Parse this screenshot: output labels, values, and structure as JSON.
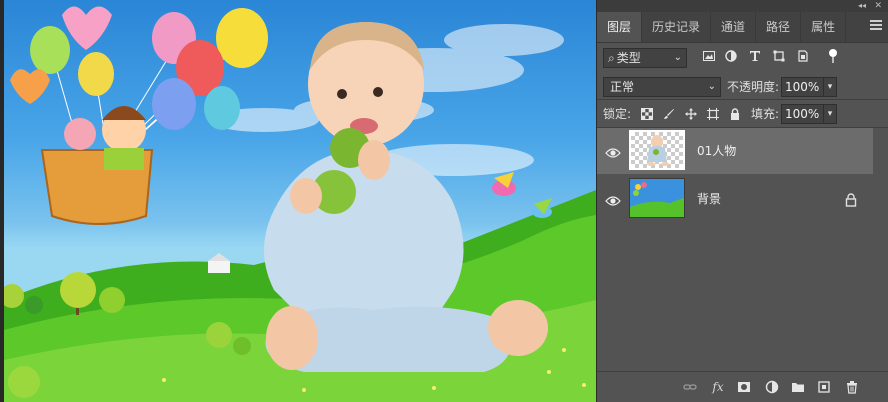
{
  "panel": {
    "tabs": [
      {
        "label": "图层",
        "active": true
      },
      {
        "label": "历史记录",
        "active": false
      },
      {
        "label": "通道",
        "active": false
      },
      {
        "label": "路径",
        "active": false
      },
      {
        "label": "属性",
        "active": false
      }
    ],
    "top_strip": {
      "collapse": "◂◂",
      "close": "✕"
    },
    "filter": {
      "search_glyph": "⌕",
      "kind_label": "类型",
      "chevron": "⌄"
    },
    "blend_mode": "正常",
    "opacity": {
      "label": "不透明度:",
      "value": "100%"
    },
    "lock": {
      "label": "锁定:"
    },
    "fill": {
      "label": "填充:",
      "value": "100%"
    },
    "layers": [
      {
        "name": "01人物",
        "visible": true,
        "selected": true,
        "locked": false
      },
      {
        "name": "背景",
        "visible": true,
        "selected": false,
        "locked": true
      }
    ],
    "bottom": {
      "fx_label": "fx"
    }
  },
  "colors": {
    "panel_bg": "#535353",
    "selected_layer": "#6c6c6c",
    "tab_bar": "#424242"
  }
}
